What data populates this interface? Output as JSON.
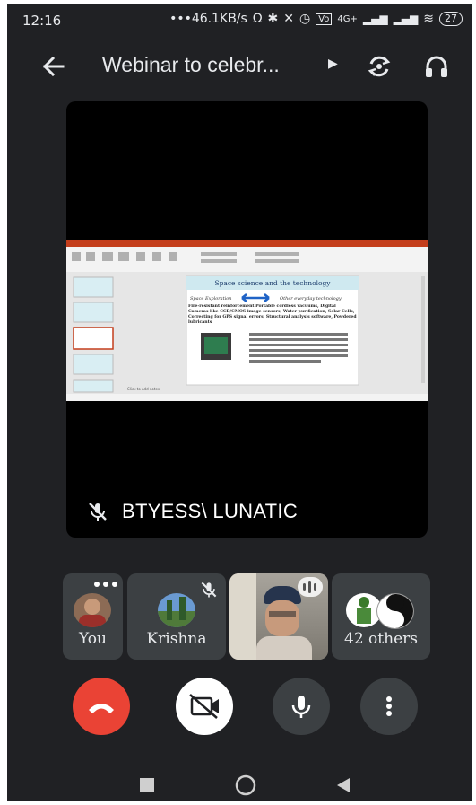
{
  "status_bar": {
    "time": "12:16",
    "speed": "•••46.1KB/s",
    "network": "4G+",
    "battery": "27"
  },
  "header": {
    "title": "Webinar to celebr...",
    "icons": [
      "back-arrow-icon",
      "chevron-right-icon",
      "switch-camera-icon",
      "headphones-icon"
    ]
  },
  "presenter": {
    "name": "BTYESS\\ LUNATIC",
    "muted_icon": "mic-off-icon"
  },
  "slide": {
    "title": "Space science and the technology",
    "left_label": "Space Exploration",
    "right_label": "Other everyday technology",
    "body": "Fire-resistant reinforcement Portable cordless vacuums, Digital Cameras like CCD/CMOS image sensors, Water purification, Solar Cells, Correcting for GPS signal errors, Structural analysis software, Powdered lubricants",
    "note_text": "Click to add notes"
  },
  "participants": [
    {
      "name": "You",
      "has_menu": true
    },
    {
      "name": "Krishna",
      "muted": true
    },
    {
      "name": "",
      "speaking": true
    },
    {
      "name": "42 others"
    }
  ],
  "controls": [
    "end-call",
    "camera-off",
    "microphone",
    "more-options"
  ],
  "colors": {
    "background": "#202124",
    "tile": "#3c4043",
    "end_call": "#ea4335",
    "text": "#e8eaed"
  }
}
